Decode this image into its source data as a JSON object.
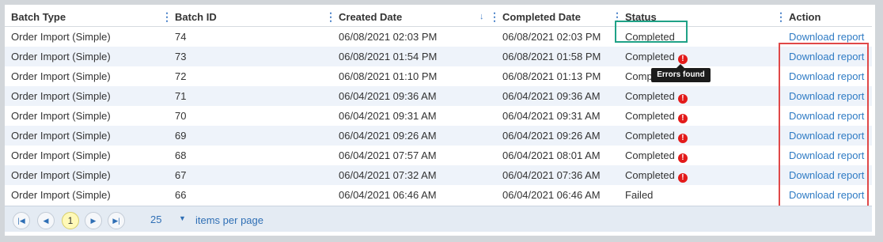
{
  "columns": [
    {
      "label": "Batch Type"
    },
    {
      "label": "Batch ID"
    },
    {
      "label": "Created Date"
    },
    {
      "label": "Completed Date"
    },
    {
      "label": "Status"
    },
    {
      "label": "Action"
    }
  ],
  "rows": [
    {
      "type": "Order Import (Simple)",
      "id": "74",
      "created": "06/08/2021 02:03 PM",
      "completed": "06/08/2021 02:03 PM",
      "status": "Completed",
      "error": false,
      "action": "Download report"
    },
    {
      "type": "Order Import (Simple)",
      "id": "73",
      "created": "06/08/2021 01:54 PM",
      "completed": "06/08/2021 01:58 PM",
      "status": "Completed",
      "error": true,
      "action": "Download report"
    },
    {
      "type": "Order Import (Simple)",
      "id": "72",
      "created": "06/08/2021 01:10 PM",
      "completed": "06/08/2021 01:13 PM",
      "status": "Completed",
      "error": false,
      "action": "Download report"
    },
    {
      "type": "Order Import (Simple)",
      "id": "71",
      "created": "06/04/2021 09:36 AM",
      "completed": "06/04/2021 09:36 AM",
      "status": "Completed",
      "error": true,
      "action": "Download report"
    },
    {
      "type": "Order Import (Simple)",
      "id": "70",
      "created": "06/04/2021 09:31 AM",
      "completed": "06/04/2021 09:31 AM",
      "status": "Completed",
      "error": true,
      "action": "Download report"
    },
    {
      "type": "Order Import (Simple)",
      "id": "69",
      "created": "06/04/2021 09:26 AM",
      "completed": "06/04/2021 09:26 AM",
      "status": "Completed",
      "error": true,
      "action": "Download report"
    },
    {
      "type": "Order Import (Simple)",
      "id": "68",
      "created": "06/04/2021 07:57 AM",
      "completed": "06/04/2021 08:01 AM",
      "status": "Completed",
      "error": true,
      "action": "Download report"
    },
    {
      "type": "Order Import (Simple)",
      "id": "67",
      "created": "06/04/2021 07:32 AM",
      "completed": "06/04/2021 07:36 AM",
      "status": "Completed",
      "error": true,
      "action": "Download report"
    },
    {
      "type": "Order Import (Simple)",
      "id": "66",
      "created": "06/04/2021 06:46 AM",
      "completed": "06/04/2021 06:46 AM",
      "status": "Failed",
      "error": false,
      "action": "Download report"
    }
  ],
  "error_icon": "exclamation-circle-icon",
  "error_color": "#e31b1b",
  "link_color": "#2f7bc4",
  "highlight_green": "#1fa287",
  "highlight_red": "#e04848",
  "tooltip": {
    "text": "Errors found"
  },
  "pager": {
    "first_icon": "first-page-icon",
    "prev_icon": "prev-page-icon",
    "next_icon": "next-page-icon",
    "last_icon": "last-page-icon",
    "current_page": "1",
    "page_size": "25",
    "items_per_page_label": "items per page"
  }
}
